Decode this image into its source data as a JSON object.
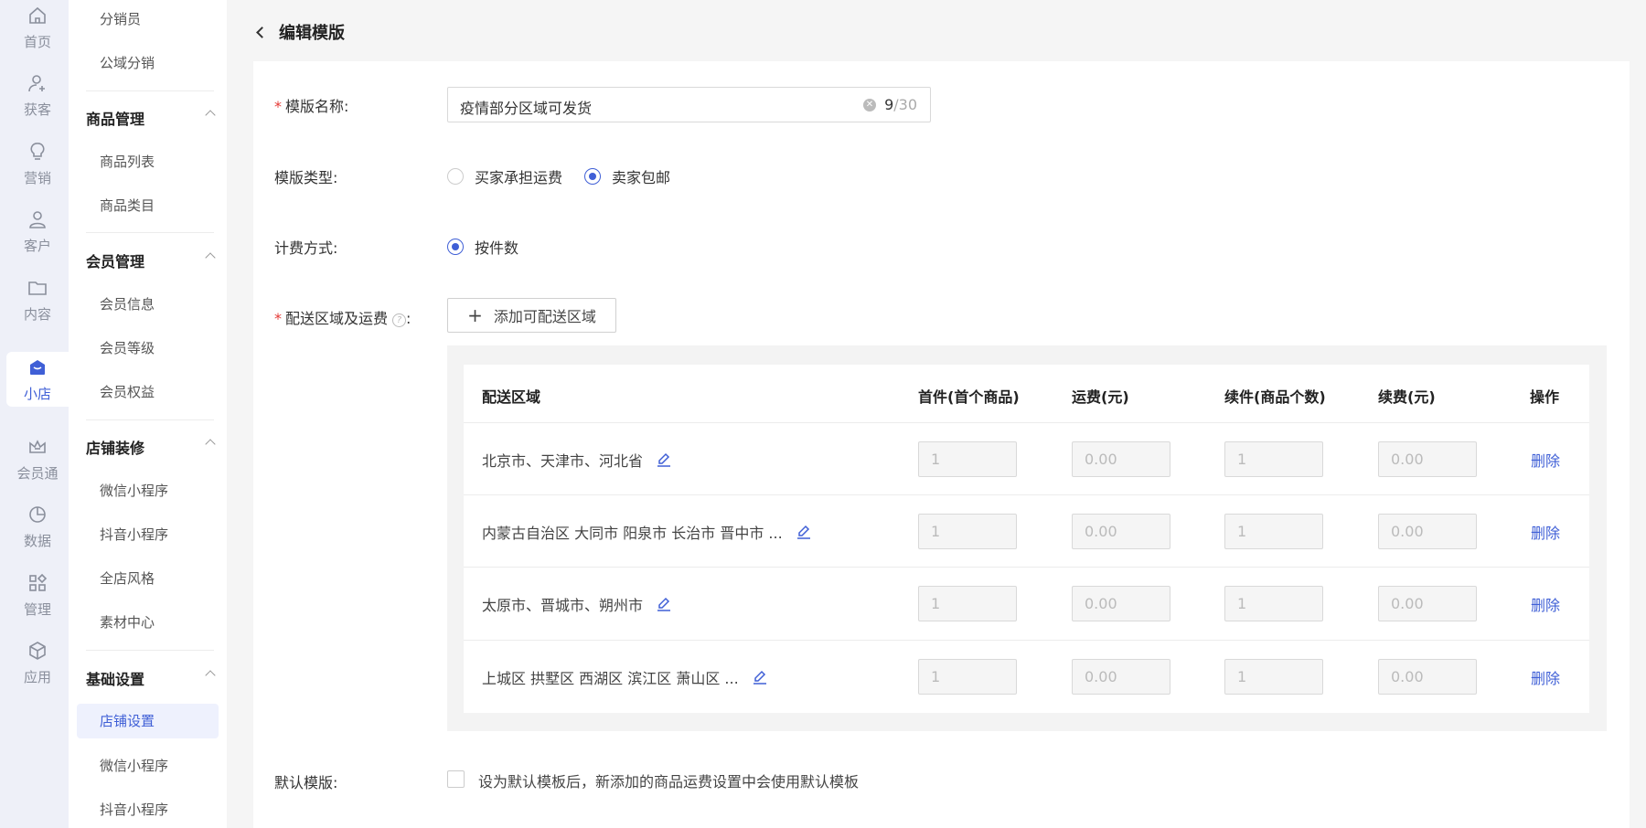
{
  "rail": [
    {
      "label": "首页",
      "icon": "home-icon"
    },
    {
      "label": "获客",
      "icon": "user-add-icon"
    },
    {
      "label": "营销",
      "icon": "bulb-icon"
    },
    {
      "label": "客户",
      "icon": "user-icon"
    },
    {
      "label": "内容",
      "icon": "folder-icon"
    },
    {
      "label": "小店",
      "icon": "shop-icon"
    },
    {
      "label": "会员通",
      "icon": "crown-icon"
    },
    {
      "label": "数据",
      "icon": "pie-chart-icon"
    },
    {
      "label": "管理",
      "icon": "apps-icon"
    },
    {
      "label": "应用",
      "icon": "box-icon"
    }
  ],
  "menu": {
    "top_items": [
      "分销员",
      "公域分销"
    ],
    "groups": [
      {
        "title": "商品管理",
        "items": [
          "商品列表",
          "商品类目"
        ]
      },
      {
        "title": "会员管理",
        "items": [
          "会员信息",
          "会员等级",
          "会员权益"
        ]
      },
      {
        "title": "店铺装修",
        "items": [
          "微信小程序",
          "抖音小程序",
          "全店风格",
          "素材中心"
        ]
      },
      {
        "title": "基础设置",
        "items": [
          "店铺设置",
          "微信小程序",
          "抖音小程序"
        ]
      }
    ]
  },
  "header": {
    "title": "编辑模版"
  },
  "form": {
    "name_label": "模版名称:",
    "name_value": "疫情部分区域可发货",
    "name_count": "9",
    "name_max": "/30",
    "type_label": "模版类型:",
    "type_options": [
      "买家承担运费",
      "卖家包邮"
    ],
    "billing_label": "计费方式:",
    "billing_option": "按件数",
    "area_label": "配送区域及运费",
    "add_area_label": "添加可配送区域",
    "default_label": "默认模版:",
    "default_text": "设为默认模板后，新添加的商品运费设置中会使用默认模板"
  },
  "table": {
    "headers": [
      "配送区域",
      "首件(首个商品)",
      "运费(元)",
      "续件(商品个数)",
      "续费(元)",
      "操作"
    ],
    "rows": [
      {
        "region": "北京市、天津市、河北省",
        "first": "1",
        "fee": "0.00",
        "next": "1",
        "next_fee": "0.00",
        "action": "删除"
      },
      {
        "region": "内蒙古自治区 大同市 阳泉市 长治市 晋中市 ...",
        "first": "1",
        "fee": "0.00",
        "next": "1",
        "next_fee": "0.00",
        "action": "删除"
      },
      {
        "region": "太原市、晋城市、朔州市",
        "first": "1",
        "fee": "0.00",
        "next": "1",
        "next_fee": "0.00",
        "action": "删除"
      },
      {
        "region": "上城区 拱墅区 西湖区 滨江区 萧山区 ...",
        "first": "1",
        "fee": "0.00",
        "next": "1",
        "next_fee": "0.00",
        "action": "删除"
      }
    ]
  },
  "colors": {
    "accent": "#3f5fd6",
    "required": "#e53935"
  }
}
